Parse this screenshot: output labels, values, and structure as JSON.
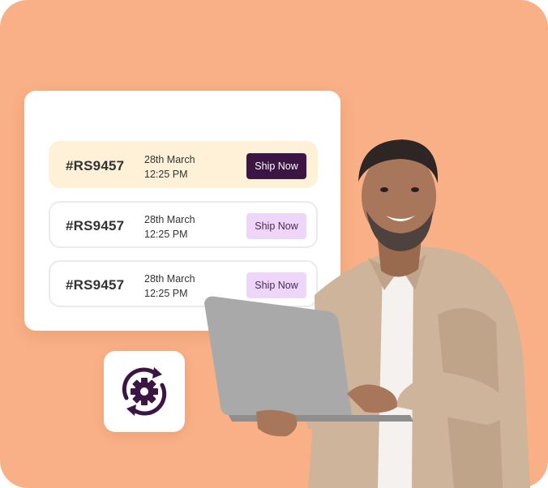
{
  "orders": [
    {
      "id": "#RS9457",
      "date": "28th March",
      "time": "12:25 PM",
      "action": "Ship Now",
      "active": true
    },
    {
      "id": "#RS9457",
      "date": "28th March",
      "time": "12:25 PM",
      "action": "Ship Now",
      "active": false
    },
    {
      "id": "#RS9457",
      "date": "28th March",
      "time": "12:25 PM",
      "action": "Ship Now",
      "active": false
    }
  ],
  "icons": {
    "sync": "gear-sync-icon"
  },
  "colors": {
    "background": "#FAB086",
    "primary_button": "#3B1543",
    "secondary_button": "#EED6FB",
    "active_row": "#FEF1D7",
    "icon": "#3B1543"
  }
}
